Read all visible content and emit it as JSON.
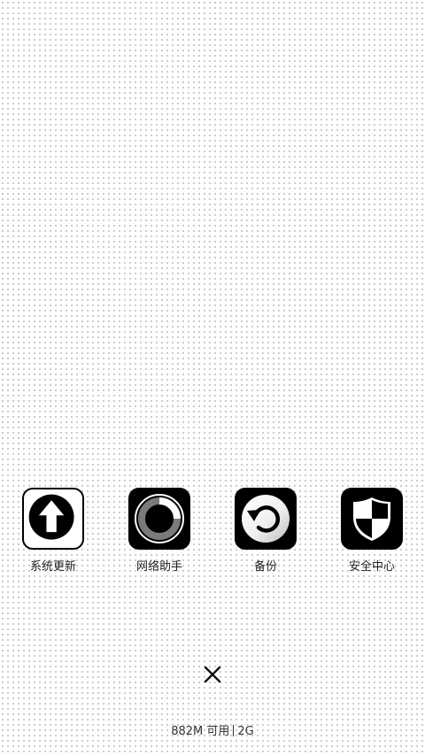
{
  "recent_apps": [
    {
      "label": "系统更新",
      "icon": "arrow-up-circle-icon"
    },
    {
      "label": "网络助手",
      "icon": "ring-gauge-icon"
    },
    {
      "label": "备份",
      "icon": "restore-arrow-icon"
    },
    {
      "label": "安全中心",
      "icon": "shield-icon"
    }
  ],
  "close": {
    "icon": "close-x-icon"
  },
  "memory": {
    "available": "882M 可用",
    "total": "2G"
  },
  "colors": {
    "icon_fill": "#000000",
    "label_text": "#222222",
    "background_dot": "#bdbdbd"
  }
}
